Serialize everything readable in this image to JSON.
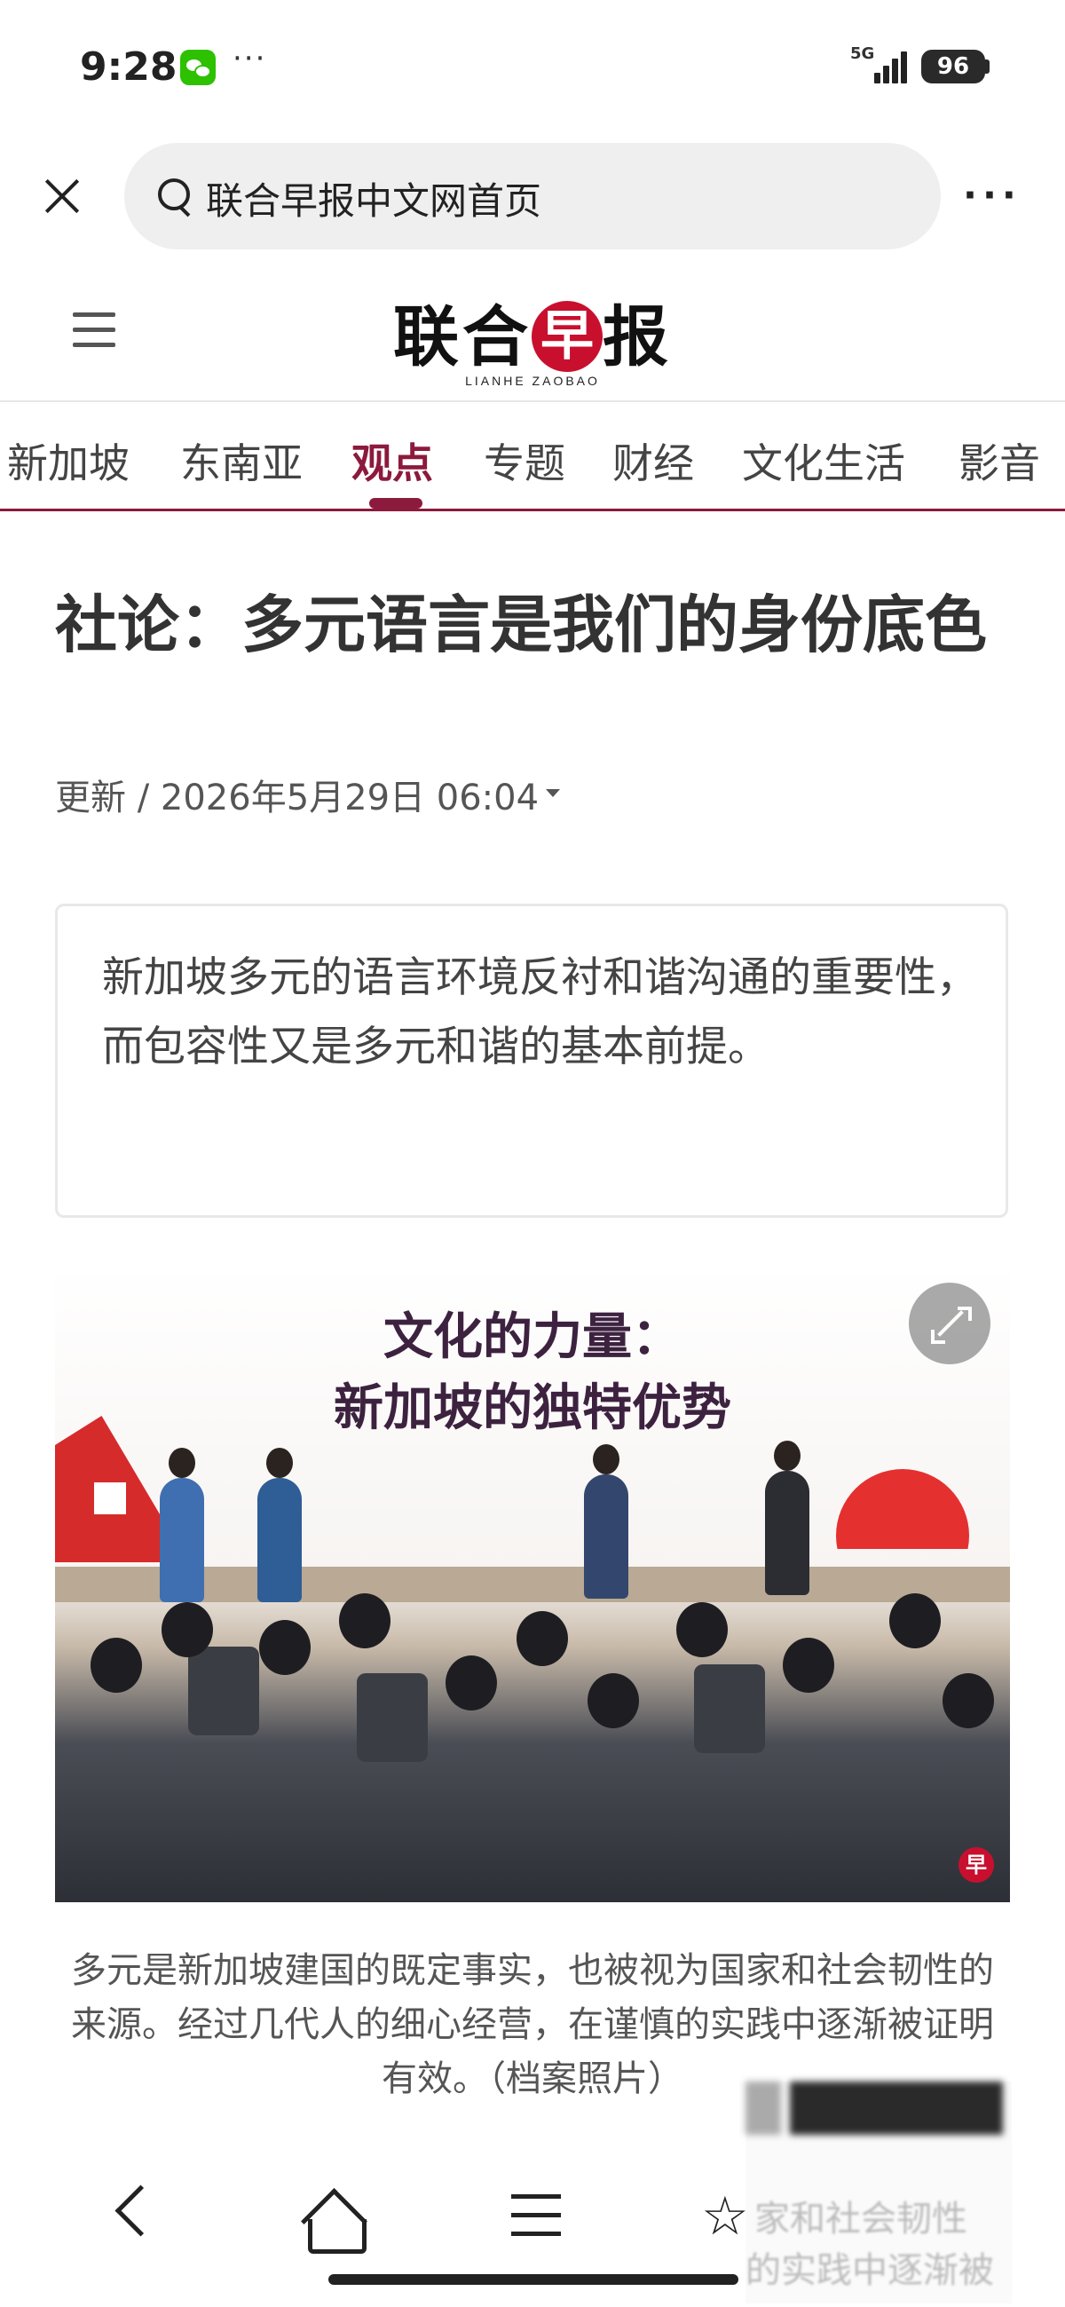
{
  "status_bar": {
    "time": "9:28",
    "more": "···",
    "network": "5G",
    "battery": "96"
  },
  "browser": {
    "url_text": "联合早报中文网首页",
    "more": "···"
  },
  "site": {
    "logo_cn_1": "联合",
    "logo_cn_red": "早",
    "logo_cn_2": "报",
    "logo_en": "LIANHE ZAOBAO",
    "accent_color": "#8c1a3c"
  },
  "nav": {
    "items": [
      {
        "label": "新加坡"
      },
      {
        "label": "东南亚"
      },
      {
        "label": "观点"
      },
      {
        "label": "专题"
      },
      {
        "label": "财经"
      },
      {
        "label": "文化生活"
      },
      {
        "label": "影音"
      }
    ],
    "active_index": 2
  },
  "article": {
    "headline": "社论：多元语言是我们的身份底色",
    "meta": "更新 / 2026年5月29日 06:04",
    "summary": "新加坡多元的语言环境反衬和谐沟通的重要性，而包容性又是多元和谐的基本前提。",
    "photo_title_1": "文化的力量：",
    "photo_title_2": "新加坡的独特优势",
    "photo_mark": "早",
    "caption": "多元是新加坡建国的既定事实，也被视为国家和社会韧性的来源。经过几代人的细心经营，在谨慎的实践中逐渐被证明有效。（档案照片）"
  },
  "floating_preview": {
    "line1": "家和社会韧性",
    "line2": "的实践中逐渐被"
  }
}
